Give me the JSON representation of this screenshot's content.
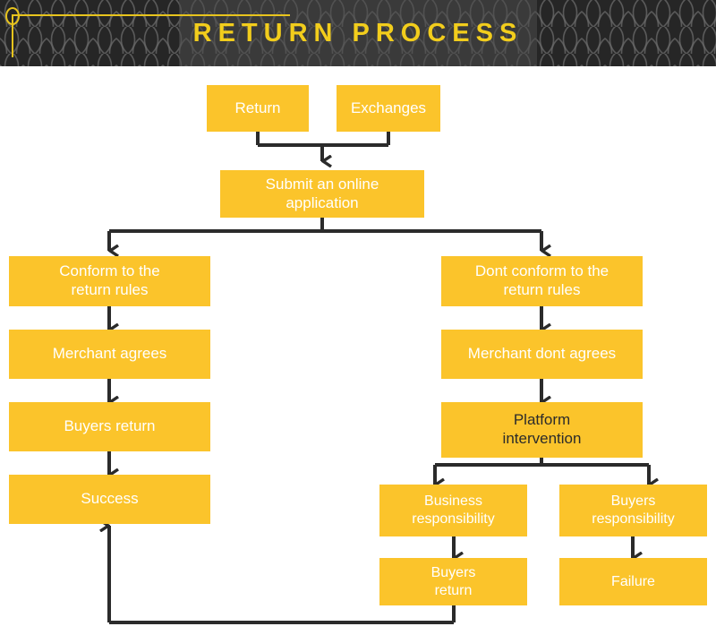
{
  "header": {
    "title": "RETURN PROCESS",
    "title_color": "#f2cd1c",
    "background_color": "#2e2e2e",
    "decoration_color": "#e8c41d"
  },
  "theme": {
    "node_fill": "#fbc42b",
    "node_text": "#ffffff",
    "node_text_alt": "#2b2b2b",
    "connector_color": "#2b2b2b",
    "canvas_background": "#ffffff"
  },
  "flowchart": {
    "nodes": [
      {
        "id": "return",
        "label": "Return",
        "text_style": "light"
      },
      {
        "id": "exchanges",
        "label": "Exchanges",
        "text_style": "light"
      },
      {
        "id": "submit",
        "label": "Submit an online\napplication",
        "text_style": "light"
      },
      {
        "id": "conform",
        "label": "Conform to the\nreturn rules",
        "text_style": "light"
      },
      {
        "id": "merchant-agrees",
        "label": "Merchant agrees",
        "text_style": "light"
      },
      {
        "id": "buyers-return-left",
        "label": "Buyers return",
        "text_style": "light"
      },
      {
        "id": "success",
        "label": "Success",
        "text_style": "light"
      },
      {
        "id": "dont-conform",
        "label": "Dont conform to the\nreturn rules",
        "text_style": "light"
      },
      {
        "id": "merchant-dont-agrees",
        "label": "Merchant dont agrees",
        "text_style": "light"
      },
      {
        "id": "platform",
        "label": "Platform\nintervention",
        "text_style": "dark"
      },
      {
        "id": "business-resp",
        "label": "Business\nresponsibility",
        "text_style": "light"
      },
      {
        "id": "buyers-resp",
        "label": "Buyers\nresponsibility",
        "text_style": "light"
      },
      {
        "id": "buyers-return-right",
        "label": "Buyers\nreturn",
        "text_style": "light"
      },
      {
        "id": "failure",
        "label": "Failure",
        "text_style": "light"
      }
    ],
    "edges": [
      {
        "from": "return",
        "to": "submit"
      },
      {
        "from": "exchanges",
        "to": "submit"
      },
      {
        "from": "submit",
        "to": "conform"
      },
      {
        "from": "submit",
        "to": "dont-conform"
      },
      {
        "from": "conform",
        "to": "merchant-agrees"
      },
      {
        "from": "merchant-agrees",
        "to": "buyers-return-left"
      },
      {
        "from": "buyers-return-left",
        "to": "success"
      },
      {
        "from": "dont-conform",
        "to": "merchant-dont-agrees"
      },
      {
        "from": "merchant-dont-agrees",
        "to": "platform"
      },
      {
        "from": "platform",
        "to": "business-resp"
      },
      {
        "from": "platform",
        "to": "buyers-resp"
      },
      {
        "from": "business-resp",
        "to": "buyers-return-right"
      },
      {
        "from": "buyers-resp",
        "to": "failure"
      },
      {
        "from": "buyers-return-right",
        "to": "success"
      }
    ]
  }
}
